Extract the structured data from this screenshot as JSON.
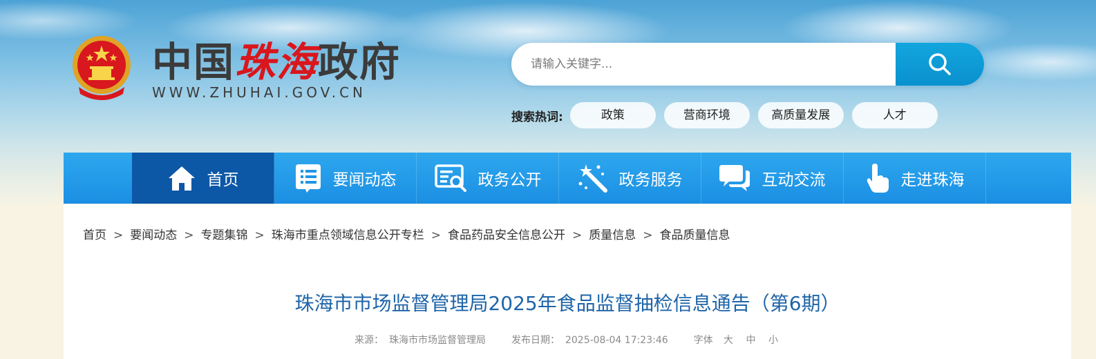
{
  "header": {
    "title_part1": "中国",
    "title_part2": "珠海",
    "title_part3": "政府",
    "url": "WWW.ZHUHAI.GOV.CN"
  },
  "search": {
    "placeholder": "请输入关键字..."
  },
  "hot": {
    "label": "搜索热词:",
    "tags": [
      "政策",
      "营商环境",
      "高质量发展",
      "人才"
    ]
  },
  "nav": {
    "items": [
      {
        "label": "首页",
        "icon": "home-icon"
      },
      {
        "label": "要闻动态",
        "icon": "news-list-icon"
      },
      {
        "label": "政务公开",
        "icon": "gov-open-icon"
      },
      {
        "label": "政务服务",
        "icon": "service-wand-icon"
      },
      {
        "label": "互动交流",
        "icon": "chat-icon"
      },
      {
        "label": "走进珠海",
        "icon": "touch-hand-icon"
      }
    ]
  },
  "breadcrumb": {
    "items": [
      "首页",
      "要闻动态",
      "专题集锦",
      "珠海市重点领域信息公开专栏",
      "食品药品安全信息公开",
      "质量信息",
      "食品质量信息"
    ],
    "separator": ">"
  },
  "article": {
    "title": "珠海市市场监督管理局2025年食品监督抽检信息通告（第6期）",
    "source_label": "来源：",
    "source": "珠海市市场监督管理局",
    "date_label": "发布日期：",
    "date": "2025-08-04 17:23:46",
    "font_label": "字体",
    "font_large": "大",
    "font_medium": "中",
    "font_small": "小"
  },
  "colors": {
    "nav_blue": "#1b8fe3",
    "nav_active": "#0c57a6",
    "title_blue": "#1e64a8",
    "logo_red": "#d9161c",
    "search_button": "#0a91cf"
  }
}
